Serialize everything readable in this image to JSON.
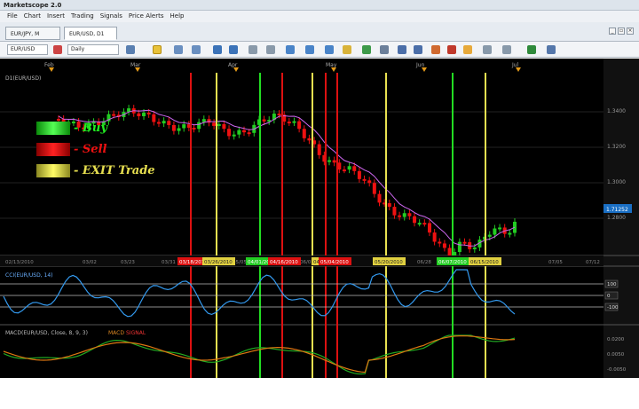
{
  "app": {
    "title": "Marketscope 2.0"
  },
  "menu": [
    "File",
    "Chart",
    "Insert",
    "Trading",
    "Signals",
    "Price Alerts",
    "Help"
  ],
  "tabs": [
    {
      "label": "EUR/JPY, M",
      "active": false
    },
    {
      "label": "EUR/USD, D1",
      "active": true
    }
  ],
  "toolbar": {
    "symbol": "EUR/USD",
    "timeframe": "Daily"
  },
  "price_panel": {
    "label": "D1(EUR/USD)",
    "current_price": "1.71252",
    "axis_ticks": [
      "1.3400",
      "1.3200",
      "1.3000",
      "1.2800"
    ],
    "months": [
      "Feb",
      "Mar",
      "Apr",
      "May",
      "Jun",
      "Jul"
    ]
  },
  "legend": {
    "buy": "- Buy",
    "sell": "- Sell",
    "exit": "- EXIT Trade",
    "colors": {
      "buy": "#22dd22",
      "sell": "#dd1111",
      "exit": "#e8e050"
    }
  },
  "date_axis": {
    "labels": [
      "02/13/2010",
      "03/02",
      "03/23",
      "03/31",
      "04/07",
      "04/14",
      "05/05",
      "05/12",
      "06/01",
      "06/21",
      "06/28",
      "07/05",
      "07/12"
    ],
    "markers": [
      {
        "text": "03/18/2010",
        "kind": "sell"
      },
      {
        "text": "03/26/2010",
        "kind": "exit"
      },
      {
        "text": "04/01/2010",
        "kind": "buy"
      },
      {
        "text": "04/16/2010",
        "kind": "sell"
      },
      {
        "text": "04/29",
        "kind": "exit"
      },
      {
        "text": "05/04/2010",
        "kind": "sell"
      },
      {
        "text": "05/20/2010",
        "kind": "exit"
      },
      {
        "text": "06/07/2010",
        "kind": "buy"
      },
      {
        "text": "06/15/2010",
        "kind": "exit"
      }
    ]
  },
  "cci_panel": {
    "label": "CCI(EUR/USD, 14)",
    "levels": [
      "100",
      "0",
      "-100"
    ]
  },
  "macd_panel": {
    "label": "MACD(EUR/USD, Close, 8, 9, 3)",
    "macd": "MACD",
    "signal": "SIGNAL",
    "ticks": [
      "0.0200",
      "0.0050",
      "-0.0050"
    ]
  },
  "colors": {
    "background": "#000000",
    "bull": "#22cc22",
    "bear": "#ee1111",
    "ma": "#cc66ee",
    "cci": "#3399ee",
    "macd": "#dd7711",
    "signal": "#22aa22"
  }
}
